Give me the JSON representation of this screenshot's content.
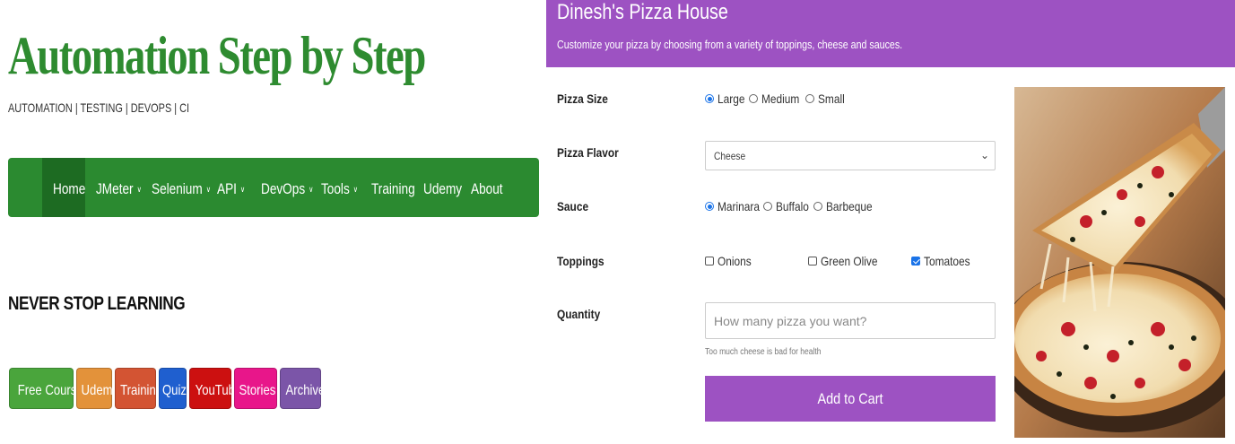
{
  "blog": {
    "title": "Automation Step by Step",
    "tagline": "AUTOMATION | TESTING | DEVOPS | CI",
    "nav": [
      {
        "label": "Home",
        "dropdown": false
      },
      {
        "label": "JMeter",
        "dropdown": true
      },
      {
        "label": "Selenium",
        "dropdown": true
      },
      {
        "label": "API",
        "dropdown": true
      },
      {
        "label": "DevOps",
        "dropdown": true
      },
      {
        "label": "Tools",
        "dropdown": true
      },
      {
        "label": "Training",
        "dropdown": false
      },
      {
        "label": "Udemy",
        "dropdown": false
      },
      {
        "label": "About",
        "dropdown": false
      }
    ],
    "slogan": "NEVER STOP LEARNING",
    "quick_links": [
      {
        "label": "Free Courses",
        "color": "#4aa53c"
      },
      {
        "label": "Udemy",
        "color": "#e3923a"
      },
      {
        "label": "Training",
        "color": "#d35433"
      },
      {
        "label": "Quiz",
        "color": "#1f5fcf"
      },
      {
        "label": "YouTube",
        "color": "#cc1010"
      },
      {
        "label": "Stories",
        "color": "#e8168a"
      },
      {
        "label": "Archives",
        "color": "#7b55a8"
      }
    ]
  },
  "pizza": {
    "title": "Dinesh's Pizza House",
    "subtitle": "Customize your pizza by choosing from a variety of toppings, cheese and sauces.",
    "accent": "#9d52c2",
    "size": {
      "label": "Pizza Size",
      "options": [
        "Large",
        "Medium",
        "Small"
      ],
      "selected": "Large"
    },
    "flavor": {
      "label": "Pizza Flavor",
      "value": "Cheese"
    },
    "sauce": {
      "label": "Sauce",
      "options": [
        "Marinara",
        "Buffalo",
        "Barbeque"
      ],
      "selected": "Marinara"
    },
    "toppings": {
      "label": "Toppings",
      "options": [
        "Onions",
        "Green Olive",
        "Tomatoes"
      ],
      "checked": [
        "Tomatoes"
      ]
    },
    "quantity": {
      "label": "Quantity",
      "placeholder": "How many pizza you want?",
      "hint": "Too much cheese is bad for health"
    },
    "cart_button": "Add to Cart",
    "image_icon": "pizza-photo"
  }
}
